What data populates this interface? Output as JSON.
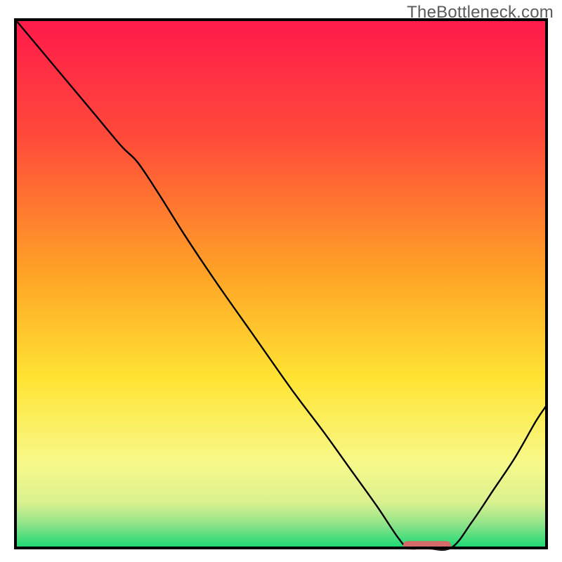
{
  "watermark": {
    "text": "TheBottleneck.com"
  },
  "chart_frame": {
    "inner_x": 22,
    "inner_y": 28,
    "inner_w": 756,
    "inner_h": 752
  },
  "chart_data": {
    "type": "line",
    "title": "",
    "xlabel": "",
    "ylabel": "",
    "xlim": [
      0,
      100
    ],
    "ylim": [
      0,
      100
    ],
    "grid": false,
    "legend": false,
    "annotations": [
      {
        "type": "min-marker",
        "color": "#d46a6a",
        "x_range": [
          73,
          82
        ],
        "y": 0.5
      }
    ],
    "gradient_stops": [
      {
        "y_pct": 0.0,
        "color": "#ff1a4b"
      },
      {
        "y_pct": 0.22,
        "color": "#ff4a3a"
      },
      {
        "y_pct": 0.48,
        "color": "#ffa326"
      },
      {
        "y_pct": 0.68,
        "color": "#ffe433"
      },
      {
        "y_pct": 0.84,
        "color": "#f7f98a"
      },
      {
        "y_pct": 0.915,
        "color": "#d9f18f"
      },
      {
        "y_pct": 0.955,
        "color": "#8fe389"
      },
      {
        "y_pct": 1.0,
        "color": "#18d874"
      }
    ],
    "curve": {
      "comment": "y read off the vertical color gradient; 100=top of plot, 0=bottom. x in 0..100 across plot width.",
      "x": [
        0,
        5,
        10,
        15,
        20,
        23,
        27,
        32,
        38,
        45,
        52,
        58,
        63,
        68,
        72,
        74,
        77,
        82,
        86,
        90,
        94,
        98,
        100
      ],
      "y": [
        100,
        94,
        88,
        82,
        76,
        73,
        67,
        59,
        50,
        40,
        30,
        22,
        15,
        8,
        2,
        0,
        0,
        0,
        5,
        11,
        17,
        24,
        27
      ]
    }
  }
}
